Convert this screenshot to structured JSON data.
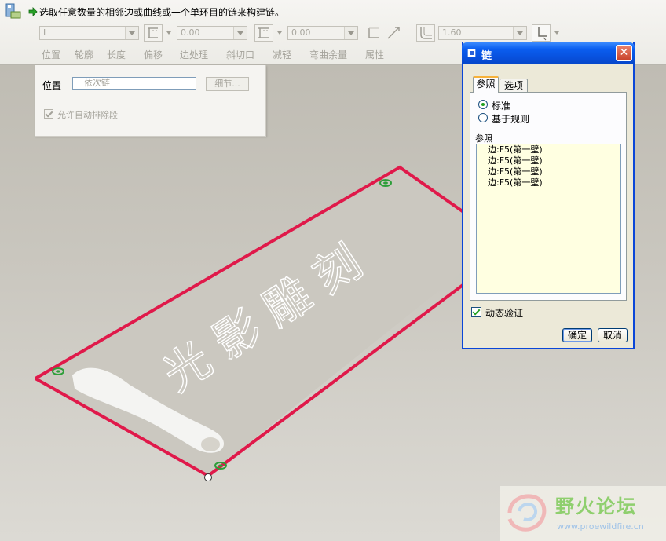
{
  "header": {
    "prompt": "选取任意数量的相邻边或曲线或一个单环目的链来构建链。"
  },
  "toolbar": {
    "type_value": "I",
    "offset_value_1": "0.00",
    "offset_value_2": "0.00",
    "thickness_value": "1.60",
    "tabs": [
      "位置",
      "轮廓",
      "长度",
      "偏移",
      "边处理",
      "斜切口",
      "减轻",
      "弯曲余量",
      "属性"
    ]
  },
  "placement_panel": {
    "label": "位置",
    "input_value": "依次链",
    "details_button": "细节...",
    "allow_auto_exclude": "允许自动排除段"
  },
  "chain_dialog": {
    "title": "链",
    "tabs": [
      "参照",
      "选项"
    ],
    "radio_standard": "标准",
    "radio_rule_based": "基于规则",
    "references_heading": "参照",
    "references": [
      "边:F5(第一壁)",
      "边:F5(第一壁)",
      "边:F5(第一壁)",
      "边:F5(第一壁)"
    ],
    "dynamic_validation": "动态验证",
    "ok": "确定",
    "cancel": "取消"
  },
  "model": {
    "engraved_text": "光影雕刻"
  },
  "watermark": {
    "title": "野火论坛",
    "url": "www.proewildfire.cn"
  },
  "colors": {
    "chain_highlight": "#e0194a",
    "dialog_title": "#0a5ef0",
    "vertex_marker": "#2e9e3a"
  }
}
